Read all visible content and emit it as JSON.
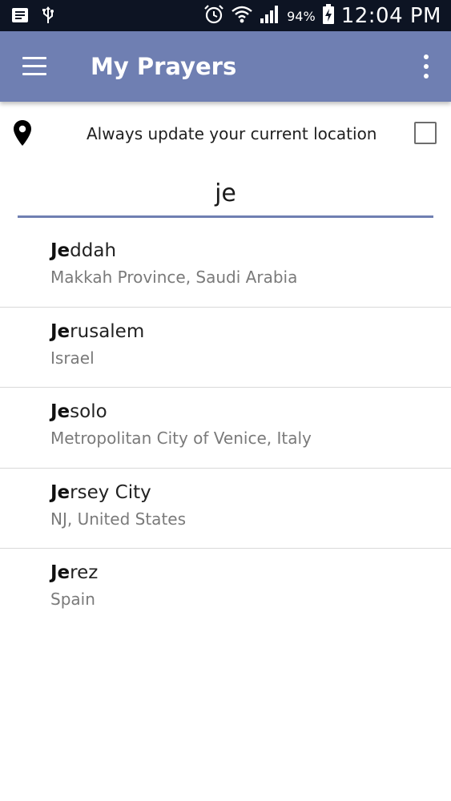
{
  "status_bar": {
    "time": "12:04 PM",
    "battery_percent": "94%",
    "icons": [
      "message-icon",
      "usb-icon",
      "alarm-icon",
      "wifi-icon",
      "signal-icon",
      "battery-charging-icon"
    ]
  },
  "app_bar": {
    "title": "My Prayers",
    "background_color": "#6f7fb2"
  },
  "location_option": {
    "label": "Always update your current location",
    "checked": false
  },
  "search": {
    "value": "je",
    "underline_color": "#6f7fb2"
  },
  "results": [
    {
      "match": "Je",
      "rest": "ddah",
      "region": "Makkah Province, Saudi Arabia"
    },
    {
      "match": "Je",
      "rest": "rusalem",
      "region": "Israel"
    },
    {
      "match": "Je",
      "rest": "solo",
      "region": "Metropolitan City of Venice, Italy"
    },
    {
      "match": "Je",
      "rest": "rsey City",
      "region": "NJ, United States"
    },
    {
      "match": "Je",
      "rest": "rez",
      "region": "Spain"
    }
  ]
}
